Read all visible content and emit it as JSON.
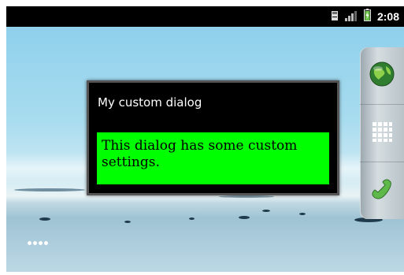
{
  "status_bar": {
    "time": "2:08",
    "icons": [
      "sd-card-icon",
      "signal-icon",
      "battery-charging-icon"
    ]
  },
  "dialog": {
    "title": "My custom dialog",
    "body_text": "This dialog has some custom settings.",
    "body_bg_color": "#00ff00",
    "window_bg_color": "#000000"
  },
  "dock": {
    "buttons": [
      "browser-icon",
      "app-drawer-icon",
      "phone-icon"
    ]
  },
  "home_screen": {
    "page_indicator": "••••"
  }
}
